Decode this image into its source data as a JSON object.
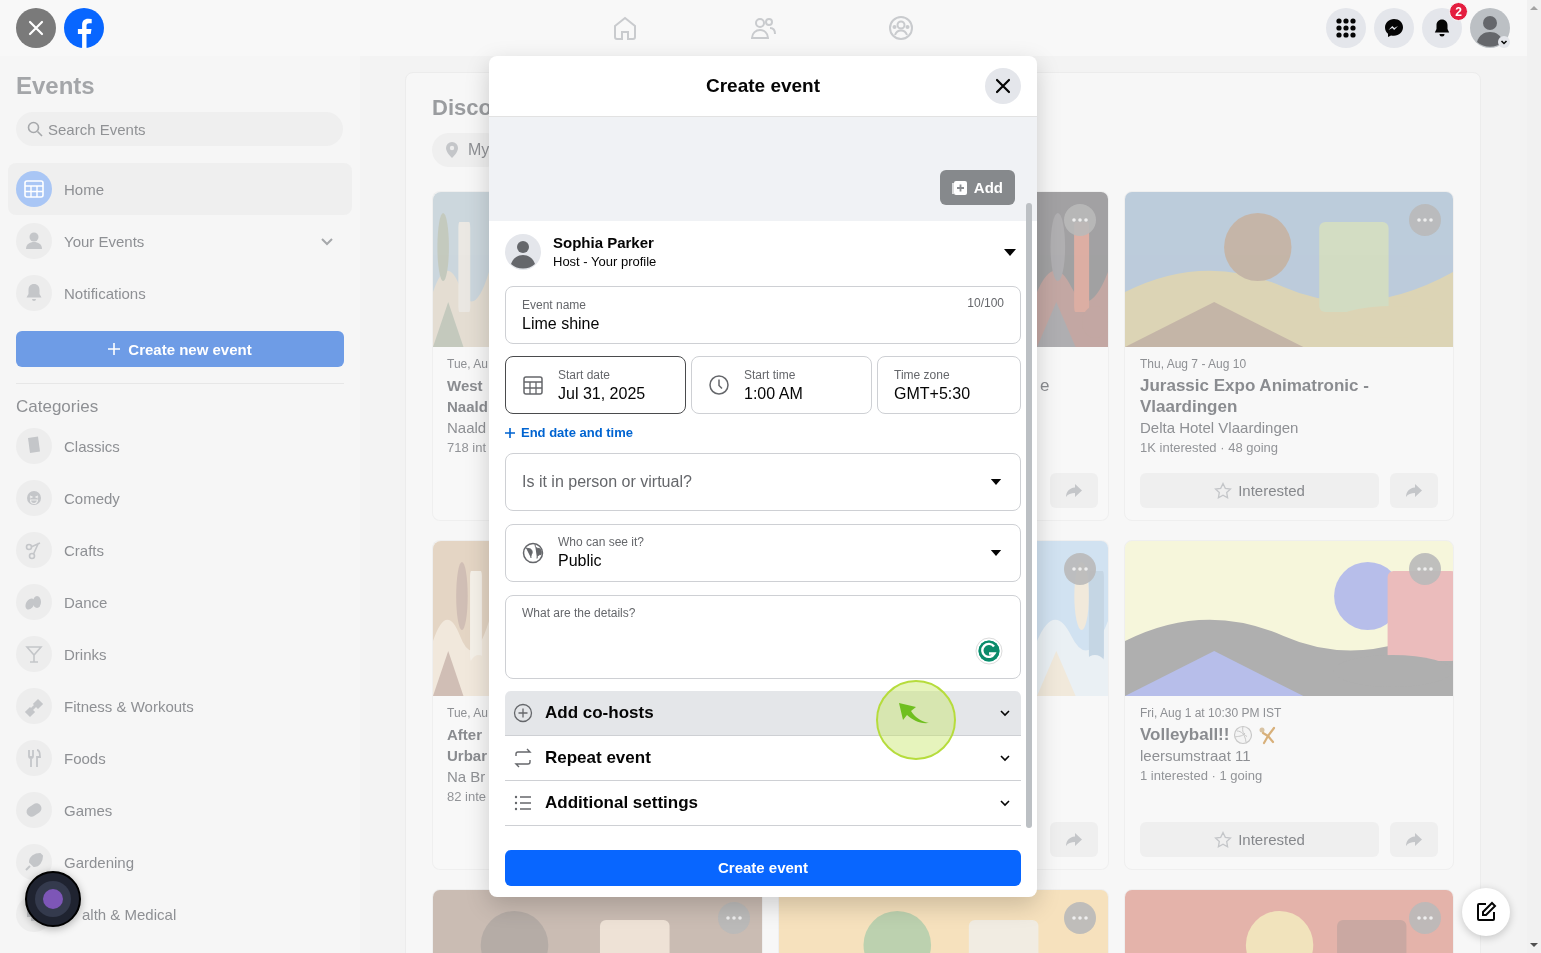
{
  "top_bar": {
    "notification_count": "2"
  },
  "sidebar": {
    "title": "Events",
    "search_placeholder": "Search Events",
    "nav": [
      {
        "label": "Home",
        "selected": true,
        "has_menu": false
      },
      {
        "label": "Your Events",
        "selected": false,
        "has_menu": true
      },
      {
        "label": "Notifications",
        "selected": false,
        "has_menu": false
      }
    ],
    "create_button": "Create new event",
    "categories_title": "Categories",
    "categories": [
      "Classics",
      "Comedy",
      "Crafts",
      "Dance",
      "Drinks",
      "Fitness & Workouts",
      "Foods",
      "Games",
      "Gardening",
      "alth & Medical"
    ]
  },
  "discover": {
    "heading": "Disco",
    "location_chip": "My",
    "cards": [
      {
        "date": "Tue, Au",
        "title_lines": [
          "West",
          "Naald"
        ],
        "location": "Naald",
        "stats": "718 int",
        "menu": false,
        "share": false
      },
      {
        "title_lines": [
          "e"
        ],
        "menu": true,
        "share": true
      },
      {
        "date": "Thu, Aug 7 - Aug 10",
        "title_lines": [
          "Jurassic Expo Animatronic -",
          "Vlaardingen"
        ],
        "location": "Delta Hotel Vlaardingen",
        "stats": "1K interested · 48 going",
        "button": "Interested",
        "menu": true,
        "share": true
      },
      {
        "date": "Tue, Au",
        "title_lines": [
          "After",
          "Urbar"
        ],
        "location": "Na Br",
        "stats": "82 inte",
        "menu": false,
        "share": false
      },
      {
        "menu": true,
        "share": true
      },
      {
        "date": "Fri, Aug 1 at 10:30 PM IST",
        "title_lines": [
          "Volleyball!!"
        ],
        "location": "leersumstraat 11",
        "stats": "1 interested · 1 going",
        "button": "Interested",
        "menu": true,
        "share": true
      },
      {
        "menu": true,
        "share": false
      },
      {
        "menu": true,
        "share": false
      },
      {
        "menu": true,
        "share": false
      }
    ]
  },
  "modal": {
    "title": "Create event",
    "cover_button": "Add",
    "host": {
      "name": "Sophia Parker",
      "role": "Host - Your profile"
    },
    "event_name": {
      "label": "Event name",
      "value": "Lime shine",
      "counter": "10/100"
    },
    "when": [
      {
        "label": "Start date",
        "value": "Jul 31, 2025",
        "focused": true
      },
      {
        "label": "Start time",
        "value": "1:00 AM",
        "focused": false
      },
      {
        "label": "Time zone",
        "value": "GMT+5:30",
        "focused": false
      }
    ],
    "end_date_link": "End date and time",
    "location_select": {
      "placeholder": "Is it in person or virtual?"
    },
    "privacy": {
      "label": "Who can see it?",
      "value": "Public"
    },
    "details": {
      "placeholder": "What are the details?"
    },
    "sections": [
      {
        "label": "Add co-hosts",
        "highlighted": true
      },
      {
        "label": "Repeat event",
        "highlighted": false
      },
      {
        "label": "Additional settings",
        "highlighted": false
      }
    ],
    "submit": "Create event"
  }
}
